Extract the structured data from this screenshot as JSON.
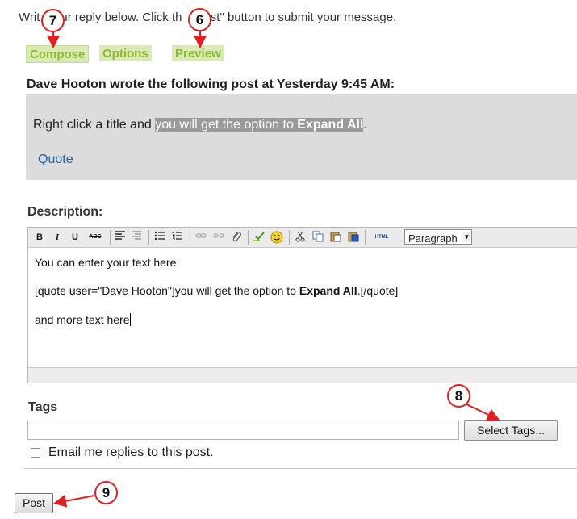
{
  "intro": {
    "part1": "Writ",
    "part2": "ur reply below. Click th",
    "part3": "ost\" button to submit your message."
  },
  "tabs": [
    {
      "label": "Compose"
    },
    {
      "label": "Options"
    },
    {
      "label": "Preview"
    }
  ],
  "post": {
    "header": "Dave Hooton wrote the following post at Yesterday 9:45 AM:",
    "text_plain": "Right click a title and ",
    "text_highlight": "you will get the option to ",
    "text_bold": "Expand All",
    "text_end": ".",
    "quote_link": "Quote"
  },
  "description": {
    "label": "Description:",
    "toolbar": {
      "bold": "B",
      "italic": "I",
      "underline": "U",
      "strike": "ABC",
      "html": "HTML",
      "paragraph": "Paragraph"
    },
    "lines": {
      "line1": "You can enter your text here",
      "line2_pre": "[quote user=\"Dave Hooton\"]you will get the option to ",
      "line2_bold": "Expand All",
      "line2_post": ".[/quote]",
      "line3": "and more text here"
    }
  },
  "tags": {
    "label": "Tags",
    "input_value": "",
    "select_button": "Select Tags..."
  },
  "email": {
    "label": "Email me replies to this post.",
    "checked": false
  },
  "post_button": "Post",
  "callouts": [
    "7",
    "6",
    "8",
    "9"
  ],
  "colors": {
    "tab_bg": "#dbe9b8",
    "tab_text": "#8bbb2a",
    "callout_border": "#e02020",
    "link": "#1a66b0"
  }
}
